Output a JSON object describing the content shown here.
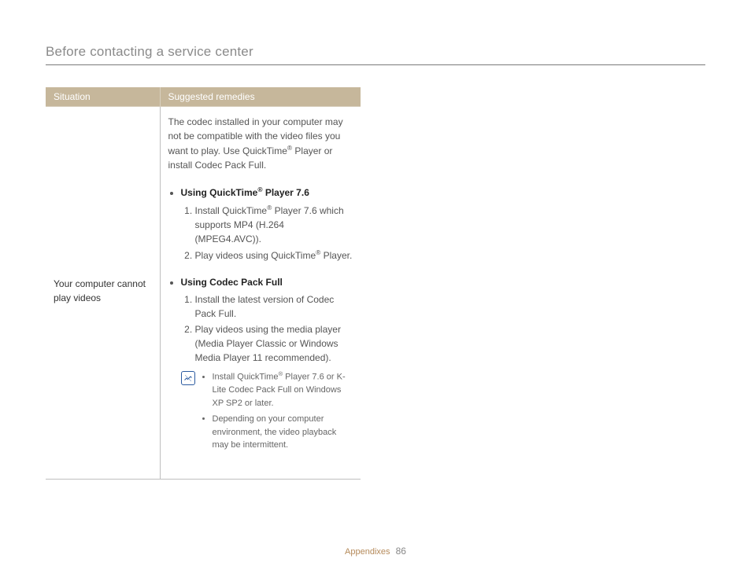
{
  "header": {
    "title": "Before contacting a service center"
  },
  "table": {
    "headers": {
      "situation": "Situation",
      "remedies": "Suggested remedies"
    },
    "row": {
      "situation": "Your computer cannot play videos",
      "remedy": {
        "intro_pre": "The codec installed in your computer may not be compatible with the video files you want to play. Use QuickTime",
        "intro_post": " Player or install Codec Pack Full.",
        "sectionA": {
          "title_pre": "Using QuickTime",
          "title_post": " Player 7.6",
          "step1_pre": "Install QuickTime",
          "step1_post": " Player 7.6 which supports MP4 (H.264 (MPEG4.AVC)).",
          "step2_pre": "Play videos using QuickTime",
          "step2_post": " Player."
        },
        "sectionB": {
          "title": "Using Codec Pack Full",
          "step1": "Install the latest version of Codec Pack Full.",
          "step2": "Play videos using the media player (Media Player Classic or Windows Media Player 11 recommended)."
        },
        "notes": {
          "n1_pre": "Install QuickTime",
          "n1_post": " Player 7.6 or K-Lite Codec Pack Full on Windows XP SP2 or later.",
          "n2": "Depending on your computer environment, the video playback may be intermittent."
        }
      }
    }
  },
  "glyphs": {
    "reg": "®"
  },
  "footer": {
    "section": "Appendixes",
    "page": "86"
  }
}
